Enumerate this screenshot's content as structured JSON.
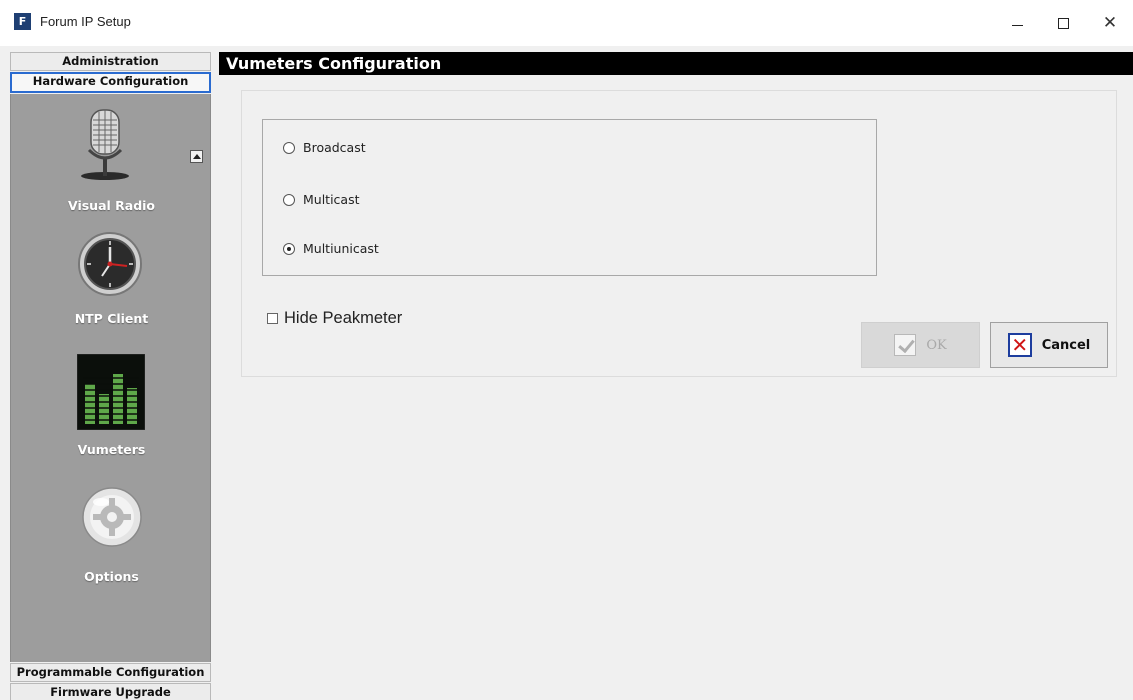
{
  "window": {
    "title": "Forum IP Setup",
    "app_icon_letter": "F",
    "controls": {
      "minimize": "minimize-icon",
      "maximize": "maximize-icon",
      "close": "✕"
    }
  },
  "sidebar": {
    "headers_top": [
      {
        "label": "Administration"
      },
      {
        "label": "Hardware Configuration",
        "active": true
      }
    ],
    "items": [
      {
        "label": "Visual Radio",
        "icon": "microphone-icon"
      },
      {
        "label": "NTP Client",
        "icon": "clock-icon"
      },
      {
        "label": "Vumeters",
        "icon": "vumeter-icon"
      },
      {
        "label": "Options",
        "icon": "options-gear-icon"
      }
    ],
    "headers_bottom": [
      {
        "label": "Programmable Configuration"
      },
      {
        "label": "Firmware Upgrade"
      }
    ]
  },
  "main": {
    "title": "Vumeters Configuration",
    "radio_options": [
      {
        "label": "Broadcast",
        "selected": false
      },
      {
        "label": "Multicast",
        "selected": false
      },
      {
        "label": "Multiunicast",
        "selected": true
      }
    ],
    "hide_peakmeter": {
      "label": "Hide Peakmeter",
      "checked": false
    },
    "buttons": {
      "ok": {
        "label": "OK",
        "enabled": false
      },
      "cancel": {
        "label": "Cancel",
        "enabled": true
      }
    }
  },
  "colors": {
    "title_bar_bg": "#000000",
    "sidebar_bg": "#9d9d9d",
    "active_header_border": "#2a6bd0",
    "cancel_x": "#d01414"
  }
}
